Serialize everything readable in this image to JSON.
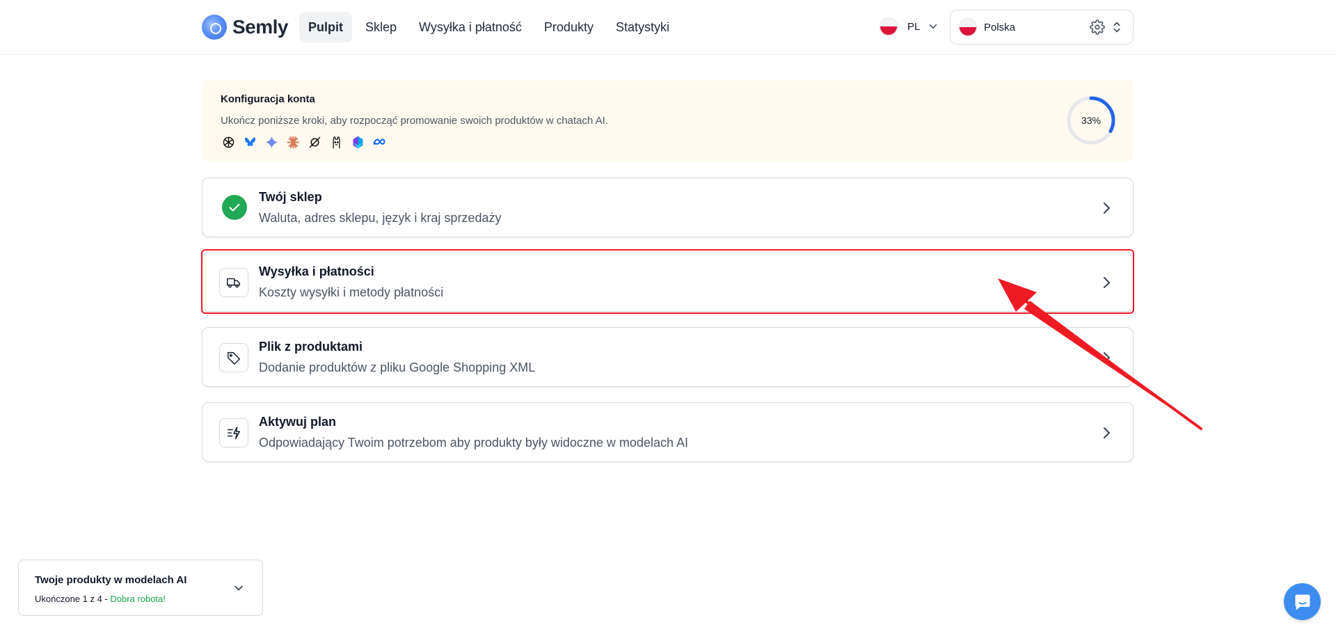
{
  "header": {
    "logo_text": "Semly",
    "nav": [
      {
        "label": "Pulpit",
        "active": true
      },
      {
        "label": "Sklep",
        "active": false
      },
      {
        "label": "Wysyłka i płatność",
        "active": false
      },
      {
        "label": "Produkty",
        "active": false
      },
      {
        "label": "Statystyki",
        "active": false
      }
    ],
    "language": {
      "code": "PL",
      "flag_icon": "poland-flag-icon"
    },
    "country": {
      "label": "Polska",
      "flag_icon": "poland-flag-icon"
    }
  },
  "banner": {
    "title": "Konfiguracja konta",
    "subtitle": "Ukończ poniższe kroki, aby rozpocząć promowanie swoich produktów w chatach AI.",
    "ai_icons": [
      "chatgpt-icon",
      "bluesky-butterfly-icon",
      "gemini-sparkle-icon",
      "claude-asterisk-icon",
      "grok-icon",
      "llama-icon",
      "copilot-icon",
      "meta-infinity-icon"
    ],
    "progress_percent": 33,
    "progress_label": "33%",
    "colors": {
      "background": "#fffaef",
      "progress": "#2563eb",
      "track": "#e5e7eb"
    }
  },
  "steps": [
    {
      "title": "Twój sklep",
      "subtitle": "Waluta, adres sklepu, język i kraj sprzedaży",
      "icon": "check-circle-icon",
      "completed": true
    },
    {
      "title": "Wysyłka i płatności",
      "subtitle": "Koszty wysyłki i metody płatności",
      "icon": "truck-icon",
      "completed": false,
      "highlighted": true
    },
    {
      "title": "Plik z produktami",
      "subtitle": "Dodanie produktów z pliku Google Shopping XML",
      "icon": "tag-icon",
      "completed": false
    },
    {
      "title": "Aktywuj plan",
      "subtitle": "Odpowiadający Twoim potrzebom aby produkty były widoczne w modelach AI",
      "icon": "bolt-list-icon",
      "completed": false
    }
  ],
  "widget": {
    "title": "Twoje produkty w modelach AI",
    "progress_text": "Ukończone 1 z 4 - ",
    "praise": "Dobra robota!"
  },
  "colors": {
    "accent_success": "#22a955",
    "annotation_red": "#ef1b24",
    "chat_button": "#3d8cf0"
  }
}
